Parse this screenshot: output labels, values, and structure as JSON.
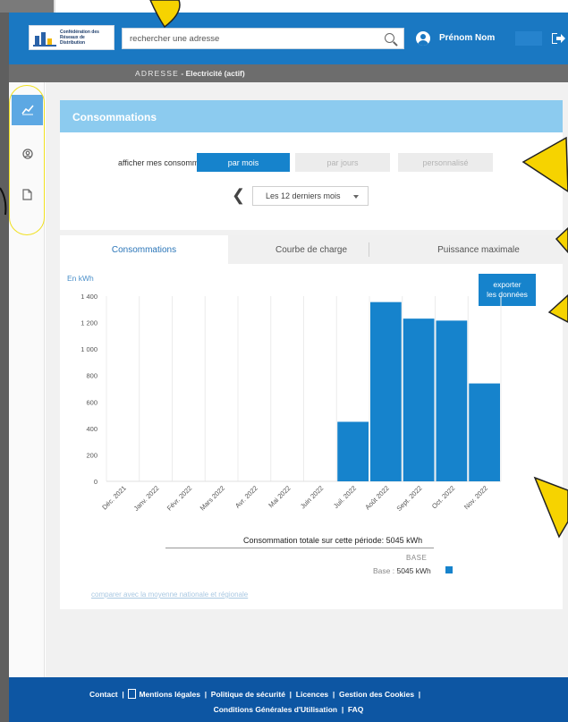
{
  "header": {
    "logo_text": [
      "Confédération des",
      "Réseaux de",
      "Distribution"
    ],
    "search_placeholder": "rechercher une adresse",
    "user_name": "Prénom Nom"
  },
  "subheader": {
    "label": "ADRESSE",
    "sub": " - Electricité (actif)"
  },
  "sidebar": {
    "items": [
      {
        "name": "chart-icon",
        "active": true
      },
      {
        "name": "user-icon",
        "active": false
      },
      {
        "name": "document-icon",
        "active": false
      }
    ]
  },
  "consumption": {
    "title": "Consommations",
    "afficher_label": "afficher mes consommations",
    "segments": [
      "par mois",
      "par jours",
      "personnalisé"
    ],
    "period": "Les 12 derniers mois"
  },
  "tabs": [
    "Consommations",
    "Courbe de charge",
    "Puissance maximale"
  ],
  "unit_label": "En kWh",
  "export_label": [
    "exporter",
    "les données"
  ],
  "chart_data": {
    "type": "bar",
    "categories": [
      "Déc. 2021",
      "Janv. 2022",
      "Févr. 2022",
      "Mars 2022",
      "Avr. 2022",
      "Mai 2022",
      "Juin 2022",
      "Juil. 2022",
      "Août 2022",
      "Sept. 2022",
      "Oct. 2022",
      "Nov. 2022"
    ],
    "values": [
      0,
      0,
      0,
      0,
      0,
      0,
      0,
      450,
      1355,
      1230,
      1215,
      740
    ],
    "yticks": [
      "0",
      "200",
      "400",
      "600",
      "800",
      "1 000",
      "1 200",
      "1 400"
    ],
    "ylim": [
      0,
      1400
    ],
    "color": "#1683cc"
  },
  "summary": {
    "total": "Consommation totale sur cette période: 5045 kWh",
    "base_header": "BASE",
    "base_label": "Base : ",
    "base_value": "5045 kWh"
  },
  "compare_link": "comparer avec la moyenne nationale et régionale",
  "footer": {
    "line1": [
      "Contact",
      "Mentions légales",
      "Politique de sécurité",
      "Licences",
      "Gestion des Cookies"
    ],
    "line2": [
      "Conditions Générales d'Utilisation",
      "FAQ"
    ]
  }
}
